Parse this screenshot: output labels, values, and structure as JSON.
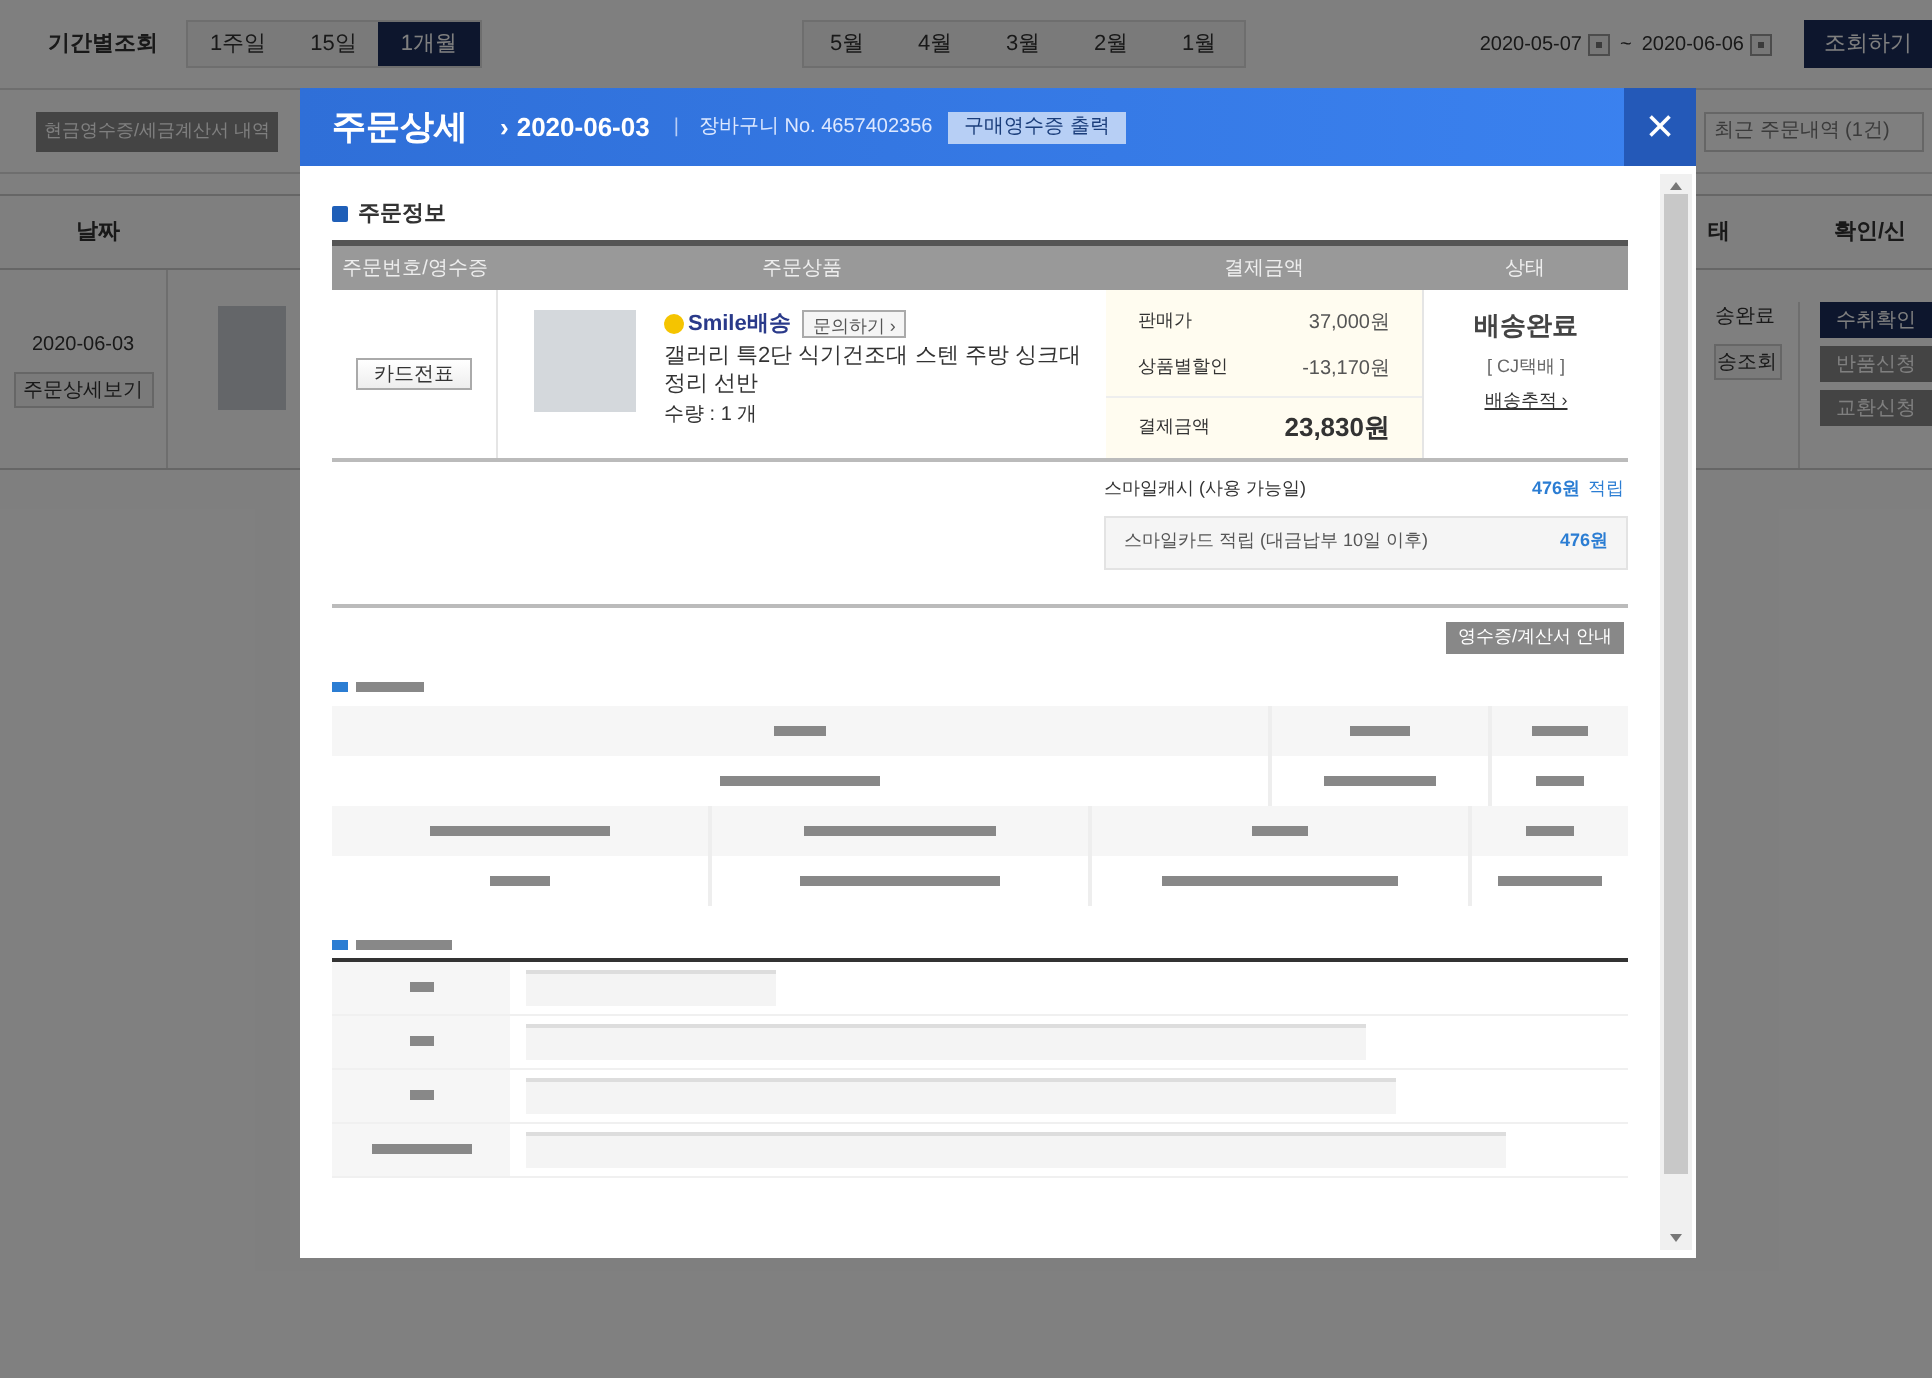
{
  "filter_bar": {
    "label": "기간별조회",
    "periods": [
      {
        "label": "1주일",
        "selected": false
      },
      {
        "label": "15일",
        "selected": false
      },
      {
        "label": "1개월",
        "selected": true
      }
    ],
    "months": [
      {
        "label": "5월",
        "selected": false
      },
      {
        "label": "4월",
        "selected": false
      },
      {
        "label": "3월",
        "selected": false
      },
      {
        "label": "2월",
        "selected": false
      },
      {
        "label": "1월",
        "selected": false
      }
    ],
    "date_from": "2020-05-07",
    "separator": "~",
    "date_to": "2020-06-06",
    "search_button": "조회하기"
  },
  "background": {
    "receipt_button": "현금영수증/세금계산서 내역",
    "recent_orders": "최근 주문내역 (1건)",
    "columns": [
      "날짜",
      "태",
      "확인/신"
    ],
    "order_date": "2020-06-03",
    "detail_button": "주문상세보기",
    "status": "송완료",
    "tracking": "송조회",
    "actions": [
      {
        "label": "수취확인",
        "kind": "primary"
      },
      {
        "label": "반품신청",
        "kind": "secondary"
      },
      {
        "label": "교환신청",
        "kind": "secondary"
      }
    ]
  },
  "modal": {
    "title": "주문상세",
    "date_arrow": "›",
    "date": "2020-06-03",
    "divider": "|",
    "cart_no": "장바구니 No. 4657402356",
    "print_button": "구매영수증 출력",
    "close": "×",
    "section_title": "주문정보",
    "columns": [
      "주문번호/영수증",
      "주문상품",
      "결제금액",
      "상태"
    ],
    "order": {
      "card_button": "카드전표",
      "delivery_badge": "Smile배송",
      "inquiry_button": "문의하기 ›",
      "product_name": "갤러리 특2단 식기건조대 스텐 주방 싱크대 정리 선반",
      "quantity": "수량 : 1 개",
      "prices": [
        {
          "label": "판매가",
          "value": "37,000원"
        },
        {
          "label": "상품별할인",
          "value": "-13,170원"
        }
      ],
      "total_label": "결제금액",
      "total": "23,830원",
      "status": "배송완료",
      "carrier": "[ CJ택배 ]",
      "tracking_link": "배송추적 ›"
    },
    "cash": {
      "label": "스마일캐시 (사용 가능일)",
      "amount": "476원",
      "suffix": "적립"
    },
    "card_reward": {
      "label": "스마일카드 적립 (대금납부 10일 이후)",
      "amount": "476원"
    },
    "receipt_guide_button": "영수증/계산서 안내"
  }
}
